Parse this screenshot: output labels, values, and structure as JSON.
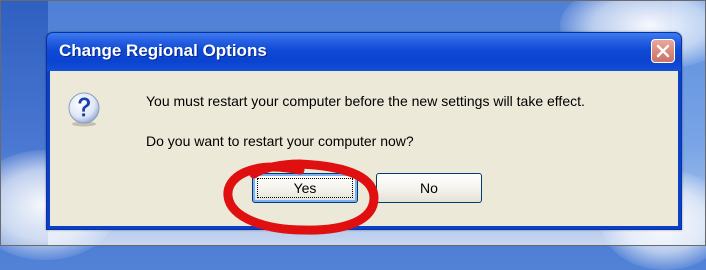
{
  "dialog": {
    "title": "Change Regional Options",
    "message_line1": "You must restart your computer before the new settings will take effect.",
    "message_line2": "Do you want to restart your computer now?",
    "icon": "question-icon",
    "buttons": {
      "yes_label": "Yes",
      "no_label": "No"
    },
    "close_icon": "close-icon"
  },
  "colors": {
    "titlebar": "#0a43cf",
    "client_background": "#ece9d8",
    "close_button": "#d7887c",
    "annotation_circle": "#e01010"
  }
}
